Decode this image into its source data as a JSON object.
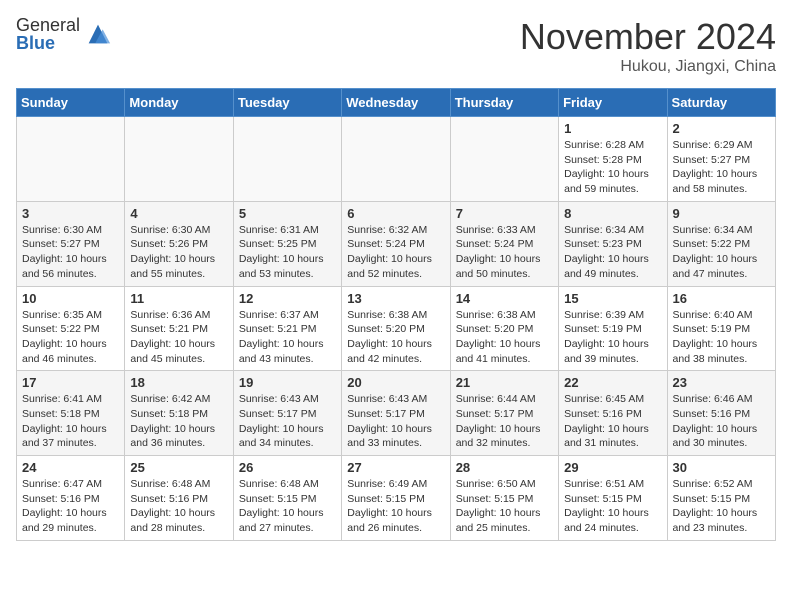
{
  "logo": {
    "general": "General",
    "blue": "Blue"
  },
  "title": "November 2024",
  "location": "Hukou, Jiangxi, China",
  "days_of_week": [
    "Sunday",
    "Monday",
    "Tuesday",
    "Wednesday",
    "Thursday",
    "Friday",
    "Saturday"
  ],
  "weeks": [
    [
      {
        "day": "",
        "info": ""
      },
      {
        "day": "",
        "info": ""
      },
      {
        "day": "",
        "info": ""
      },
      {
        "day": "",
        "info": ""
      },
      {
        "day": "",
        "info": ""
      },
      {
        "day": "1",
        "info": "Sunrise: 6:28 AM\nSunset: 5:28 PM\nDaylight: 10 hours and 59 minutes."
      },
      {
        "day": "2",
        "info": "Sunrise: 6:29 AM\nSunset: 5:27 PM\nDaylight: 10 hours and 58 minutes."
      }
    ],
    [
      {
        "day": "3",
        "info": "Sunrise: 6:30 AM\nSunset: 5:27 PM\nDaylight: 10 hours and 56 minutes."
      },
      {
        "day": "4",
        "info": "Sunrise: 6:30 AM\nSunset: 5:26 PM\nDaylight: 10 hours and 55 minutes."
      },
      {
        "day": "5",
        "info": "Sunrise: 6:31 AM\nSunset: 5:25 PM\nDaylight: 10 hours and 53 minutes."
      },
      {
        "day": "6",
        "info": "Sunrise: 6:32 AM\nSunset: 5:24 PM\nDaylight: 10 hours and 52 minutes."
      },
      {
        "day": "7",
        "info": "Sunrise: 6:33 AM\nSunset: 5:24 PM\nDaylight: 10 hours and 50 minutes."
      },
      {
        "day": "8",
        "info": "Sunrise: 6:34 AM\nSunset: 5:23 PM\nDaylight: 10 hours and 49 minutes."
      },
      {
        "day": "9",
        "info": "Sunrise: 6:34 AM\nSunset: 5:22 PM\nDaylight: 10 hours and 47 minutes."
      }
    ],
    [
      {
        "day": "10",
        "info": "Sunrise: 6:35 AM\nSunset: 5:22 PM\nDaylight: 10 hours and 46 minutes."
      },
      {
        "day": "11",
        "info": "Sunrise: 6:36 AM\nSunset: 5:21 PM\nDaylight: 10 hours and 45 minutes."
      },
      {
        "day": "12",
        "info": "Sunrise: 6:37 AM\nSunset: 5:21 PM\nDaylight: 10 hours and 43 minutes."
      },
      {
        "day": "13",
        "info": "Sunrise: 6:38 AM\nSunset: 5:20 PM\nDaylight: 10 hours and 42 minutes."
      },
      {
        "day": "14",
        "info": "Sunrise: 6:38 AM\nSunset: 5:20 PM\nDaylight: 10 hours and 41 minutes."
      },
      {
        "day": "15",
        "info": "Sunrise: 6:39 AM\nSunset: 5:19 PM\nDaylight: 10 hours and 39 minutes."
      },
      {
        "day": "16",
        "info": "Sunrise: 6:40 AM\nSunset: 5:19 PM\nDaylight: 10 hours and 38 minutes."
      }
    ],
    [
      {
        "day": "17",
        "info": "Sunrise: 6:41 AM\nSunset: 5:18 PM\nDaylight: 10 hours and 37 minutes."
      },
      {
        "day": "18",
        "info": "Sunrise: 6:42 AM\nSunset: 5:18 PM\nDaylight: 10 hours and 36 minutes."
      },
      {
        "day": "19",
        "info": "Sunrise: 6:43 AM\nSunset: 5:17 PM\nDaylight: 10 hours and 34 minutes."
      },
      {
        "day": "20",
        "info": "Sunrise: 6:43 AM\nSunset: 5:17 PM\nDaylight: 10 hours and 33 minutes."
      },
      {
        "day": "21",
        "info": "Sunrise: 6:44 AM\nSunset: 5:17 PM\nDaylight: 10 hours and 32 minutes."
      },
      {
        "day": "22",
        "info": "Sunrise: 6:45 AM\nSunset: 5:16 PM\nDaylight: 10 hours and 31 minutes."
      },
      {
        "day": "23",
        "info": "Sunrise: 6:46 AM\nSunset: 5:16 PM\nDaylight: 10 hours and 30 minutes."
      }
    ],
    [
      {
        "day": "24",
        "info": "Sunrise: 6:47 AM\nSunset: 5:16 PM\nDaylight: 10 hours and 29 minutes."
      },
      {
        "day": "25",
        "info": "Sunrise: 6:48 AM\nSunset: 5:16 PM\nDaylight: 10 hours and 28 minutes."
      },
      {
        "day": "26",
        "info": "Sunrise: 6:48 AM\nSunset: 5:15 PM\nDaylight: 10 hours and 27 minutes."
      },
      {
        "day": "27",
        "info": "Sunrise: 6:49 AM\nSunset: 5:15 PM\nDaylight: 10 hours and 26 minutes."
      },
      {
        "day": "28",
        "info": "Sunrise: 6:50 AM\nSunset: 5:15 PM\nDaylight: 10 hours and 25 minutes."
      },
      {
        "day": "29",
        "info": "Sunrise: 6:51 AM\nSunset: 5:15 PM\nDaylight: 10 hours and 24 minutes."
      },
      {
        "day": "30",
        "info": "Sunrise: 6:52 AM\nSunset: 5:15 PM\nDaylight: 10 hours and 23 minutes."
      }
    ]
  ]
}
